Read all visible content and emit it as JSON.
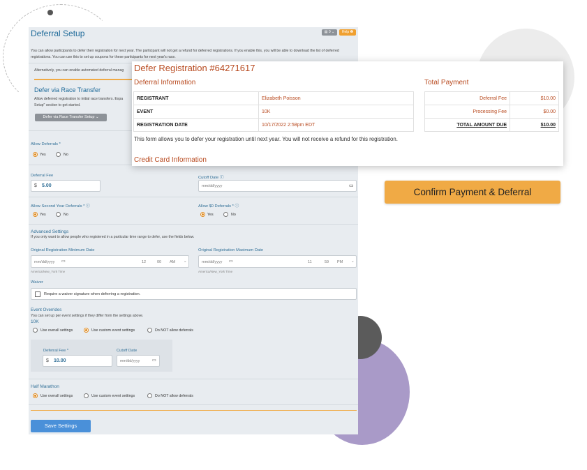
{
  "setup": {
    "title": "Deferral Setup",
    "badge_id": "0",
    "badge_help": "Help",
    "intro": "You can allow participants to defer their registration for next year. The participant will not get a refund for deferred registrations. If you enable this, you will be able to download the list of deferred registrations. You can use this to set up coupons for these participants for next year's race.",
    "alt_notice": "Alternatively, you can enable automated deferral manag",
    "race_transfer_title": "Defer via Race Transfer",
    "race_transfer_desc_1": "Allow deferred registration to initial race transfers. Expa",
    "race_transfer_desc_2": "Setup\" section to get started.",
    "race_transfer_button": "Defer via Race Transfer Setup",
    "allow_deferrals_label": "Allow Deferrals *",
    "yes": "Yes",
    "no": "No",
    "deferral_fee_label": "Deferral Fee",
    "currency": "$",
    "deferral_fee_value": "5.00",
    "cutoff_date_label": "Cutoff Date",
    "date_placeholder": "mm/dd/yyyy",
    "allow_second_year_label": "Allow Second Year Deferrals *",
    "allow_zero_label": "Allow $0 Deferrals *",
    "advanced_title": "Advanced Settings",
    "advanced_desc": "If you only want to allow people who registered in a particular time range to defer, use the fields below.",
    "min_date_label": "Original Registration Minimum Date",
    "max_date_label": "Original Registration Maximum Date",
    "min_hour": "12",
    "min_minute": "00",
    "min_ampm": "AM",
    "max_hour": "11",
    "max_minute": "59",
    "max_ampm": "PM",
    "timezone": "America/New_York Time",
    "waiver_title": "Waiver",
    "waiver_checkbox": "Require a waiver signature when deferring a registration.",
    "overrides_title": "Event Overrides",
    "overrides_desc": "You can set up per event settings if they differ from the settings above.",
    "event_10k": "10K",
    "use_overall": "Use overall settings",
    "use_custom": "Use custom event settings",
    "do_not_allow": "Do NOT allow deferrals",
    "override_fee_label": "Deferral Fee *",
    "override_fee_value": "10.00",
    "override_cutoff_label": "Cutoff Date",
    "event_half": "Half Marathon",
    "save_button": "Save Settings"
  },
  "popup": {
    "title": "Defer Registration #64271617",
    "info_title": "Deferral Information",
    "rows": [
      {
        "key": "REGISTRANT",
        "value": "Elizabeth Poisson"
      },
      {
        "key": "EVENT",
        "value": "10K"
      },
      {
        "key": "REGISTRATION DATE",
        "value": "10/17/2022 2:58pm EDT"
      }
    ],
    "notice": "This form allows you to defer your registration until next year. You will not receive a refund for this registration.",
    "cc_title": "Credit Card Information",
    "payment_title": "Total Payment",
    "payment_rows": [
      {
        "key": "Deferral Fee",
        "value": "$10.00"
      },
      {
        "key": "Processing Fee",
        "value": "$0.00"
      },
      {
        "key": "TOTAL AMOUNT DUE",
        "value": "$10.00"
      }
    ]
  },
  "confirm_button": "Confirm Payment & Deferral",
  "colors": {
    "accent": "#b84a1f",
    "button_orange": "#f0aa45",
    "link_blue": "#2f6e96",
    "save_blue": "#4a90d9"
  }
}
